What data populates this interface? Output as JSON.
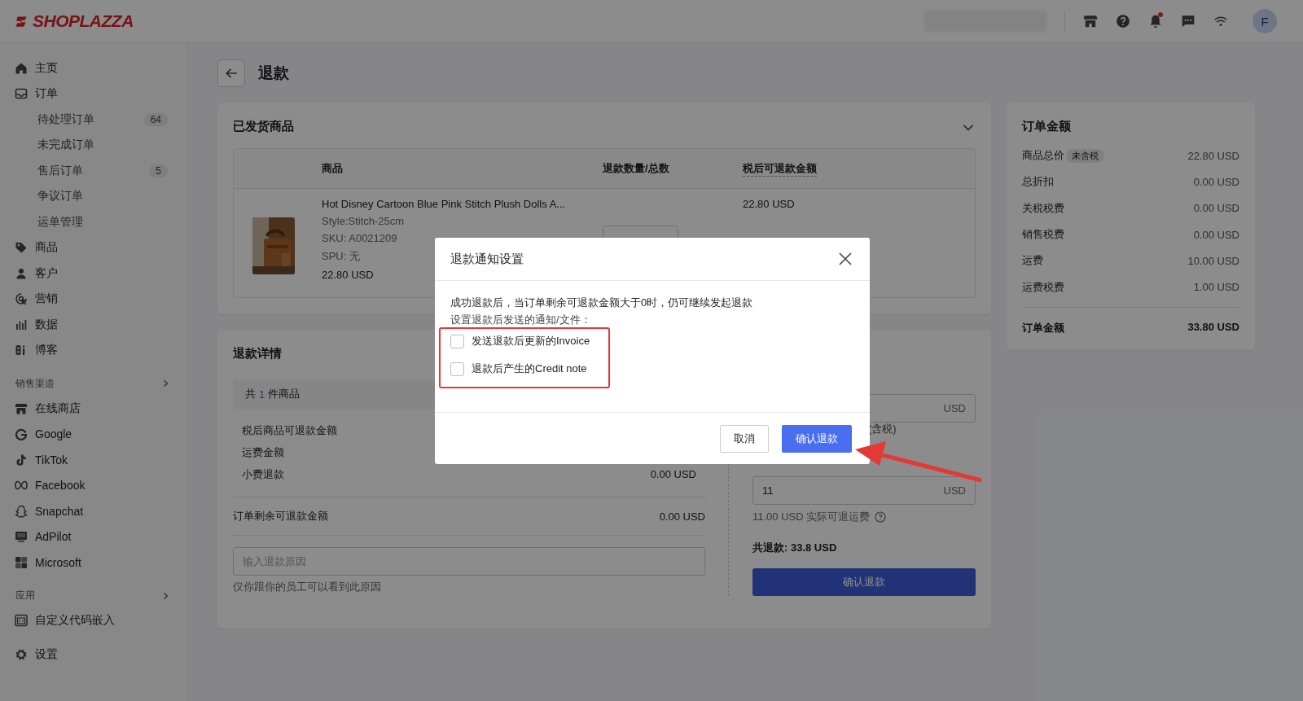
{
  "brand": {
    "name": "SHOPLAZZA"
  },
  "topbar": {
    "bell_unread": true,
    "avatar": "F"
  },
  "sidebar": {
    "sections": [
      {
        "items": [
          {
            "label": "主页"
          },
          {
            "label": "订单",
            "children": [
              {
                "label": "待处理订单",
                "badge": "64"
              },
              {
                "label": "未完成订单"
              },
              {
                "label": "售后订单",
                "badge": "5"
              },
              {
                "label": "争议订单"
              },
              {
                "label": "运单管理"
              }
            ]
          },
          {
            "label": "商品"
          },
          {
            "label": "客户"
          },
          {
            "label": "营销"
          },
          {
            "label": "数据"
          },
          {
            "label": "博客"
          }
        ]
      },
      {
        "title": "销售渠道",
        "items": [
          {
            "label": "在线商店"
          },
          {
            "label": "Google"
          },
          {
            "label": "TikTok"
          },
          {
            "label": "Facebook"
          },
          {
            "label": "Snapchat"
          },
          {
            "label": "AdPilot"
          },
          {
            "label": "Microsoft"
          }
        ]
      },
      {
        "title": "应用",
        "items": [
          {
            "label": "自定义代码嵌入"
          }
        ]
      },
      {
        "items": [
          {
            "label": "设置"
          }
        ]
      }
    ]
  },
  "page": {
    "title": "退款"
  },
  "shipped_items": {
    "title": "已发货商品",
    "columns": [
      "商品",
      "退款数量/总数",
      "税后可退款金额"
    ],
    "rows": [
      {
        "name": "Hot Disney Cartoon Blue Pink Stitch Plush Dolls A...",
        "style": "Style:Stitch-25cm",
        "sku": "SKU: A0021209",
        "spu": "SPU: 无",
        "price": "22.80 USD",
        "refund_amount": "22.80 USD"
      }
    ]
  },
  "refund_details": {
    "title": "退款详情",
    "summary": {
      "prefix": "共",
      "count": "1",
      "suffix": "件商品"
    },
    "rows": [
      {
        "label": "税后商品可退款金额"
      },
      {
        "label": "运费金额"
      },
      {
        "label": "小费退款",
        "value": "0.00 USD"
      }
    ],
    "remaining": {
      "label": "订单剩余可退款金额",
      "value": "0.00 USD"
    },
    "reason": {
      "placeholder": "输入退款原因",
      "hint": "仅你跟你的员工可以看到此原因"
    },
    "form": {
      "amount_unit": "USD",
      "amount_note": "(含税)",
      "shipping_value": "11",
      "shipping_unit": "USD",
      "shipping_hint": "11.00 USD 实际可退运费",
      "total": "共退款: 33.8 USD",
      "confirm": "确认退款"
    }
  },
  "order_amount": {
    "title": "订单金额",
    "rows": [
      {
        "label": "商品总价",
        "tag": "未含税",
        "value": "22.80 USD"
      },
      {
        "label": "总折扣",
        "value": "0.00 USD"
      },
      {
        "label": "关税税费",
        "value": "0.00 USD"
      },
      {
        "label": "销售税费",
        "value": "0.00 USD"
      },
      {
        "label": "运费",
        "value": "10.00 USD"
      },
      {
        "label": "运费税费",
        "value": "1.00 USD"
      }
    ],
    "total": {
      "label": "订单金额",
      "value": "33.80 USD"
    }
  },
  "modal": {
    "title": "退款通知设置",
    "description": "成功退款后，当订单剩余可退款金额大于0时，仍可继续发起退款",
    "options_label": "设置退款后发送的通知/文件：",
    "options": [
      {
        "label": "发送退款后更新的Invoice",
        "checked": false
      },
      {
        "label": "退款后产生的Credit note",
        "checked": false
      }
    ],
    "buttons": [
      {
        "label": "取消",
        "kind": "secondary"
      },
      {
        "label": "确认退款",
        "kind": "primary"
      }
    ]
  }
}
